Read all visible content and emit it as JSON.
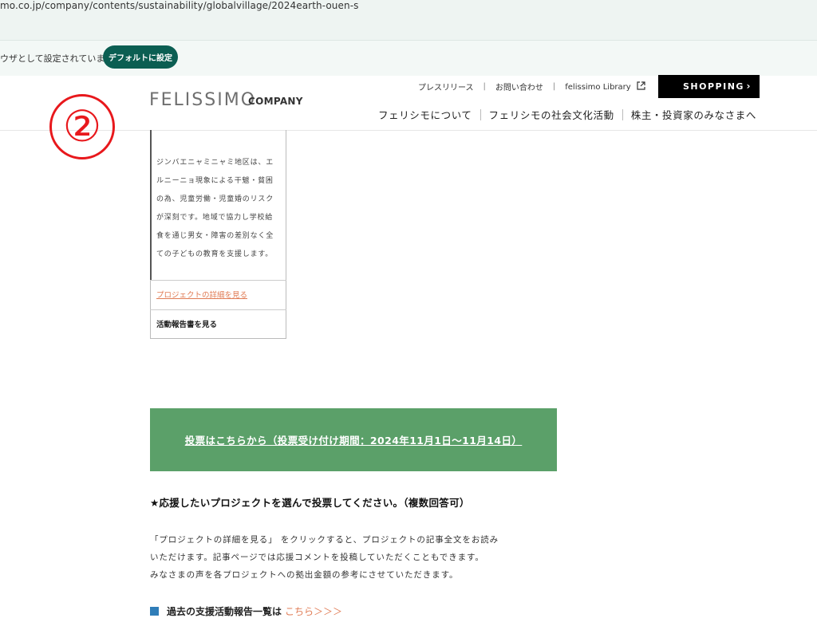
{
  "browser": {
    "url": "mo.co.jp/company/contents/sustainability/globalvillage/2024earth-ouen-s",
    "infobar_text": "ウザとして設定されていません",
    "default_button": "デフォルトに設定"
  },
  "header": {
    "logo": "FELISSIMO",
    "company": "COMPANY",
    "top_links": [
      "プレスリリース",
      "お問い合わせ",
      "felissimo Library"
    ],
    "shopping": "SHOPPING",
    "main_nav": [
      "フェリシモについて",
      "フェリシモの社会文化活動",
      "株主・投資家のみなさまへ"
    ]
  },
  "annotation": {
    "circled_number": "②",
    "color": "#e8181c"
  },
  "card": {
    "description_lines": [
      "ジンバエニャミニャミ地区は、エ",
      "ルニーニョ現象による干魃・貧困",
      "の為、児童労働・児童婚のリスク",
      "が深刻です。地域で協力し学校給",
      "食を通じ男女・障害の差別なく全",
      "ての子どもの教育を支援します。"
    ],
    "details_link": "プロジェクトの詳細を見る",
    "report_link": "活動報告書を見る"
  },
  "vote": {
    "label": "投票はこちらから（投票受け付け期間：2024年11月1日〜11月14日）",
    "bg": "#5ba069"
  },
  "content": {
    "heading": "★応援したいプロジェクトを選んで投票してください。（複数回答可）",
    "paragraph_lines": [
      "「プロジェクトの詳細を見る」 をクリックすると、プロジェクトの記事全文をお読み",
      "いただけます。記事ページでは応援コメントを投稿していただくこともできます。",
      "みなさまの声を各プロジェクトへの拠出金額の参考にさせていただきます。"
    ],
    "past_text": "過去の支援活動報告一覧は",
    "past_link": "こちら＞＞＞"
  }
}
